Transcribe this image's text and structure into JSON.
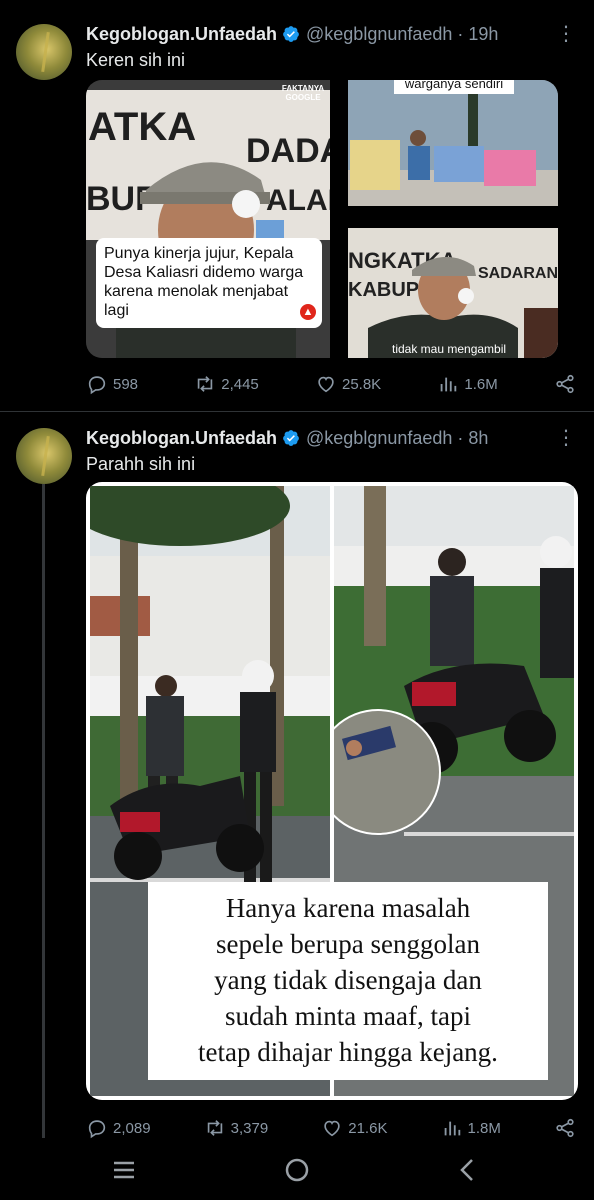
{
  "tweets": [
    {
      "author_name": "Kegoblogan.Unfaedah",
      "handle": "@kegblgnunfaedh",
      "time": "· 19h",
      "text": "Keren sih ini",
      "media": {
        "banner_text_left": "ATKA  DADARA  BUF  ALANG",
        "caption": "Punya kinerja jujur, Kepala Desa Kaliasri didemo warga karena menolak menjabat lagi",
        "watermark": "FAKTANYA GOOGLE",
        "top_right_caption": "warganya sendiri",
        "bottom_right_banner": "NGKATKA  SADARAN H  KABUP",
        "bottom_right_caption": "tidak mau mengambil"
      },
      "stats": {
        "replies": "598",
        "retweets": "2,445",
        "likes": "25.8K",
        "views": "1.6M"
      }
    },
    {
      "author_name": "Kegoblogan.Unfaedah",
      "handle": "@kegblgnunfaedh",
      "time": "· 8h",
      "text": "Parahh sih ini",
      "media": {
        "caption_lines": [
          "Hanya karena masalah",
          "sepele berupa senggolan",
          "yang tidak disengaja dan",
          "sudah minta maaf,  tapi",
          "tetap dihajar hingga kejang."
        ]
      },
      "stats": {
        "replies": "2,089",
        "retweets": "3,379",
        "likes": "21.6K",
        "views": "1.8M"
      }
    }
  ],
  "icons": {
    "verified": "verified-badge-icon",
    "more": "more-options-icon",
    "reply": "reply-icon",
    "retweet": "retweet-icon",
    "like": "heart-icon",
    "views": "views-chart-icon",
    "share": "share-icon"
  },
  "navbar": {
    "recent": "recent-apps-icon",
    "home": "home-icon",
    "back": "back-icon"
  },
  "colors": {
    "verified": "#1d9bf0",
    "muted": "#8b98a5",
    "text": "#e7e9ea"
  }
}
